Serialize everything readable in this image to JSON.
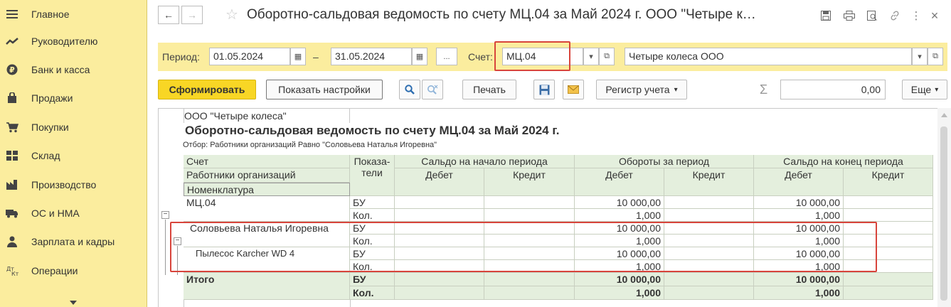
{
  "sidebar": {
    "items": [
      {
        "label": "Главное",
        "icon": "menu-lines-icon"
      },
      {
        "label": "Руководителю",
        "icon": "trend-chart-icon"
      },
      {
        "label": "Банк и касса",
        "icon": "ruble-coin-icon"
      },
      {
        "label": "Продажи",
        "icon": "shopping-bag-icon"
      },
      {
        "label": "Покупки",
        "icon": "shopping-cart-icon"
      },
      {
        "label": "Склад",
        "icon": "warehouse-grid-icon"
      },
      {
        "label": "Производство",
        "icon": "factory-icon"
      },
      {
        "label": "ОС и НМА",
        "icon": "truck-icon"
      },
      {
        "label": "Зарплата и кадры",
        "icon": "person-icon"
      },
      {
        "label": "Операции",
        "icon": "dt-kt-icon"
      }
    ]
  },
  "header": {
    "title": "Оборотно-сальдовая ведомость по счету МЦ.04 за Май 2024 г. ООО \"Четыре к…"
  },
  "filter": {
    "period_label": "Период:",
    "date_from": "01.05.2024",
    "dash": "–",
    "date_to": "31.05.2024",
    "dots": "...",
    "account_label": "Счет:",
    "account": "МЦ.04",
    "organization": "Четыре колеса ООО"
  },
  "toolbar": {
    "generate": "Сформировать",
    "show_settings": "Показать настройки",
    "print": "Печать",
    "register": "Регистр учета",
    "sum_value": "0,00",
    "more": "Еще"
  },
  "report": {
    "org": "ООО \"Четыре колеса\"",
    "title": "Оборотно-сальдовая ведомость по счету МЦ.04 за Май 2024 г.",
    "filter_text": "Отбор: Работники организаций Равно \"Соловьева Наталья Игоревна\"",
    "col_account": "Счет",
    "col_employees": "Работники организаций",
    "col_nomenclature": "Номенклатура",
    "col_indicators": "Показа-\nтели",
    "col_start": "Сальдо на начало периода",
    "col_turnover": "Обороты за период",
    "col_end": "Сальдо на конец периода",
    "debit": "Дебет",
    "credit": "Кредит",
    "rows": [
      {
        "name": "МЦ.04",
        "ind1": "БУ",
        "ind2": "Кол.",
        "turn_debit1": "10 000,00",
        "turn_debit2": "1,000",
        "end_debit1": "10 000,00",
        "end_debit2": "1,000"
      },
      {
        "name": "Соловьева Наталья Игоревна",
        "ind1": "БУ",
        "ind2": "Кол.",
        "turn_debit1": "10 000,00",
        "turn_debit2": "1,000",
        "end_debit1": "10 000,00",
        "end_debit2": "1,000"
      },
      {
        "name": "Пылесос Karcher WD 4",
        "ind1": "БУ",
        "ind2": "Кол.",
        "turn_debit1": "10 000,00",
        "turn_debit2": "1,000",
        "end_debit1": "10 000,00",
        "end_debit2": "1,000"
      }
    ],
    "total": {
      "name": "Итого",
      "ind1": "БУ",
      "ind2": "Кол.",
      "turn_debit1": "10 000,00",
      "turn_debit2": "1,000",
      "end_debit1": "10 000,00",
      "end_debit2": "1,000"
    }
  },
  "colors": {
    "accent": "#f8d625",
    "sidebar_bg": "#fbed9e",
    "header_green": "#e4efdd",
    "highlight_red": "#d8453c"
  }
}
